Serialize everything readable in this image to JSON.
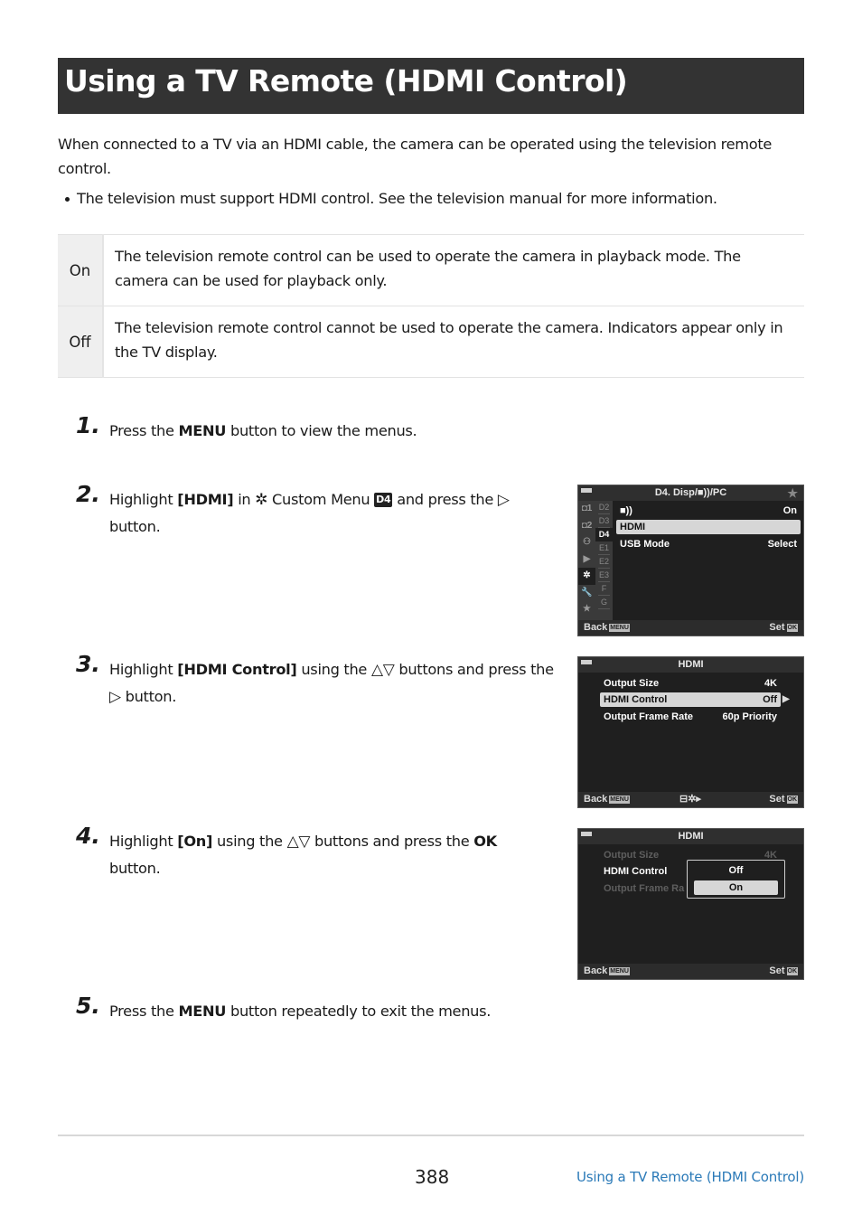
{
  "page": {
    "title": "Using a TV Remote (HDMI Control)",
    "intro": "When connected to a TV via an HDMI cable, the camera can be operated using the television remote control.",
    "bullet": "The television must support HDMI control. See the television manual for more information."
  },
  "options_table": [
    {
      "key": "On",
      "description": "The television remote control can be used to operate the camera in playback mode. The camera can be used for playback only."
    },
    {
      "key": "Off",
      "description": "The television remote control cannot be used to operate the camera. Indicators appear only in the TV display."
    }
  ],
  "steps": [
    {
      "num": "1.",
      "pre": "Press the ",
      "bold": "MENU",
      "post": " button to view the menus."
    },
    {
      "num": "2.",
      "pre": "Highlight ",
      "bold": "[HDMI]",
      "mid": " in ",
      "icon": "✲",
      "mid2": " Custom Menu ",
      "badge": "D4",
      "post": " and press the ",
      "arrow": "▷",
      "post2": " button."
    },
    {
      "num": "3.",
      "pre": "Highlight ",
      "bold": "[HDMI Control]",
      "mid": " using the ",
      "arrows": "△▽",
      "mid2": " buttons and press the ",
      "arrow": "▷",
      "post": " button."
    },
    {
      "num": "4.",
      "pre": "Highlight ",
      "bold": "[On]",
      "mid": " using the ",
      "arrows": "△▽",
      "mid2": " buttons and press the ",
      "bold2": "OK",
      "post": " button."
    },
    {
      "num": "5.",
      "pre": "Press the ",
      "bold": "MENU",
      "post": " button repeatedly to exit the menus."
    }
  ],
  "screen1": {
    "header": "D4. Disp/■))/PC",
    "tabs_main": [
      "◘1",
      "◘2",
      "⚇",
      "▶",
      "✲",
      "🔧",
      "★"
    ],
    "tabs_sub": [
      "D2",
      "D3",
      "D4",
      "E1",
      "E2",
      "E3",
      "F",
      "G"
    ],
    "rows": [
      {
        "label": "■))",
        "value": "On"
      },
      {
        "label": "HDMI",
        "value": ""
      },
      {
        "label": "USB Mode",
        "value": "Select"
      }
    ],
    "back": "Back",
    "menu_tag": "MENU",
    "set": "Set",
    "ok_tag": "OK"
  },
  "screen2": {
    "header": "HDMI",
    "rows": [
      {
        "label": "Output Size",
        "value": "4K"
      },
      {
        "label": "HDMI Control",
        "value": "Off"
      },
      {
        "label": "Output Frame Rate",
        "value": "60p Priority"
      }
    ],
    "back": "Back",
    "menu_tag": "MENU",
    "set": "Set",
    "ok_tag": "OK",
    "center_icon": "⊟✲▸"
  },
  "screen3": {
    "header": "HDMI",
    "rows": [
      {
        "label": "Output Size",
        "value": "4K"
      },
      {
        "label": "HDMI Control",
        "value": ""
      },
      {
        "label": "Output Frame Ra",
        "value": ""
      }
    ],
    "popup_options": [
      "Off",
      "On"
    ],
    "back": "Back",
    "menu_tag": "MENU",
    "set": "Set",
    "ok_tag": "OK"
  },
  "footer": {
    "page_number": "388",
    "link": "Using a TV Remote (HDMI Control)"
  }
}
